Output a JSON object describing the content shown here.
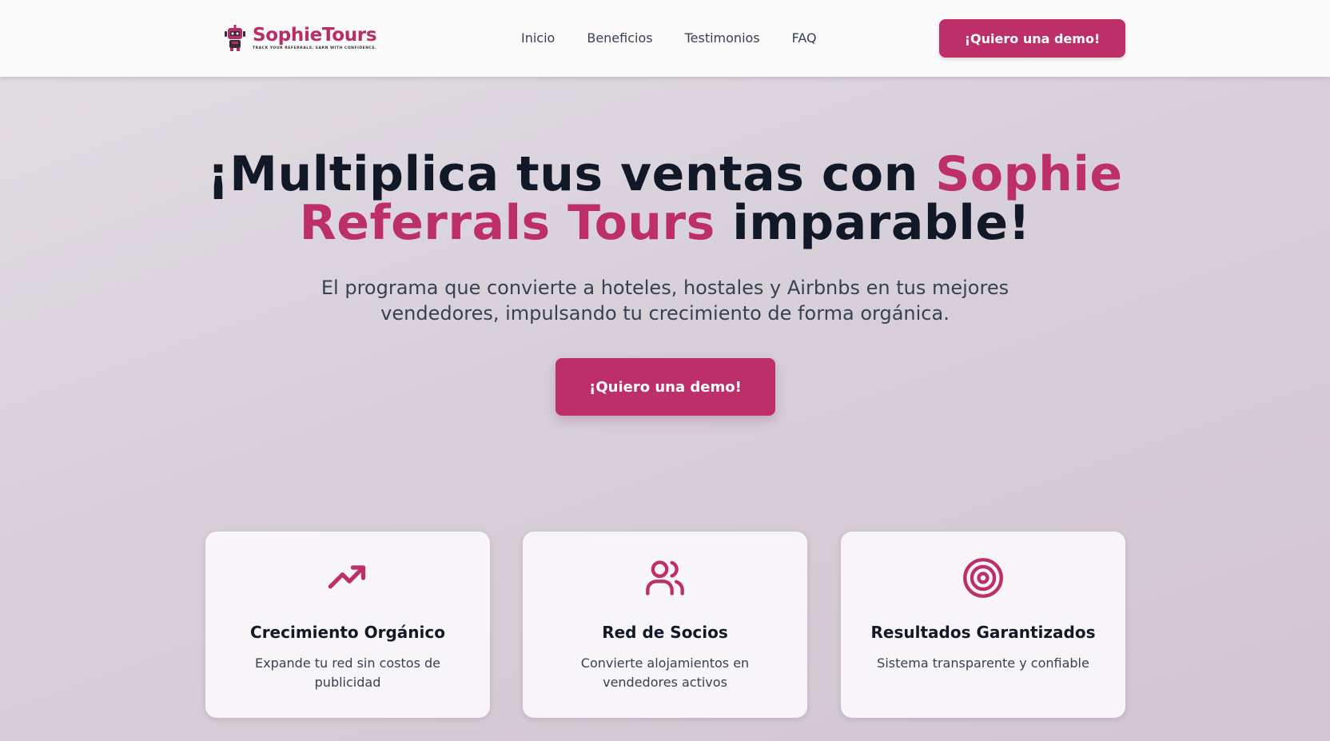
{
  "header": {
    "logo": {
      "name": "SophieTours",
      "tagline": "TRACK YOUR REFERRALS. EARN WITH CONFIDENCE.",
      "icon": "robot-logo-icon"
    },
    "nav": [
      "Inicio",
      "Beneficios",
      "Testimonios",
      "FAQ"
    ],
    "cta_label": "¡Quiero una demo!"
  },
  "hero": {
    "title_part1": "¡Multiplica tus ventas con ",
    "title_accent": "Sophie Referrals Tours",
    "title_part2": " imparable!",
    "subtitle": "El programa que convierte a hoteles, hostales y Airbnbs en tus mejores vendedores, impulsando tu crecimiento de forma orgánica.",
    "cta_label": "¡Quiero una demo!"
  },
  "features": [
    {
      "icon": "trending-up-icon",
      "title": "Crecimiento Orgánico",
      "description": "Expande tu red sin costos de publicidad"
    },
    {
      "icon": "users-icon",
      "title": "Red de Socios",
      "description": "Convierte alojamientos en vendedores activos"
    },
    {
      "icon": "target-icon",
      "title": "Resultados Garantizados",
      "description": "Sistema transparente y confiable"
    }
  ],
  "colors": {
    "brand": "#bc2f68",
    "heading": "#111827",
    "body_text": "#374151",
    "header_bg": "#fbfafb"
  }
}
